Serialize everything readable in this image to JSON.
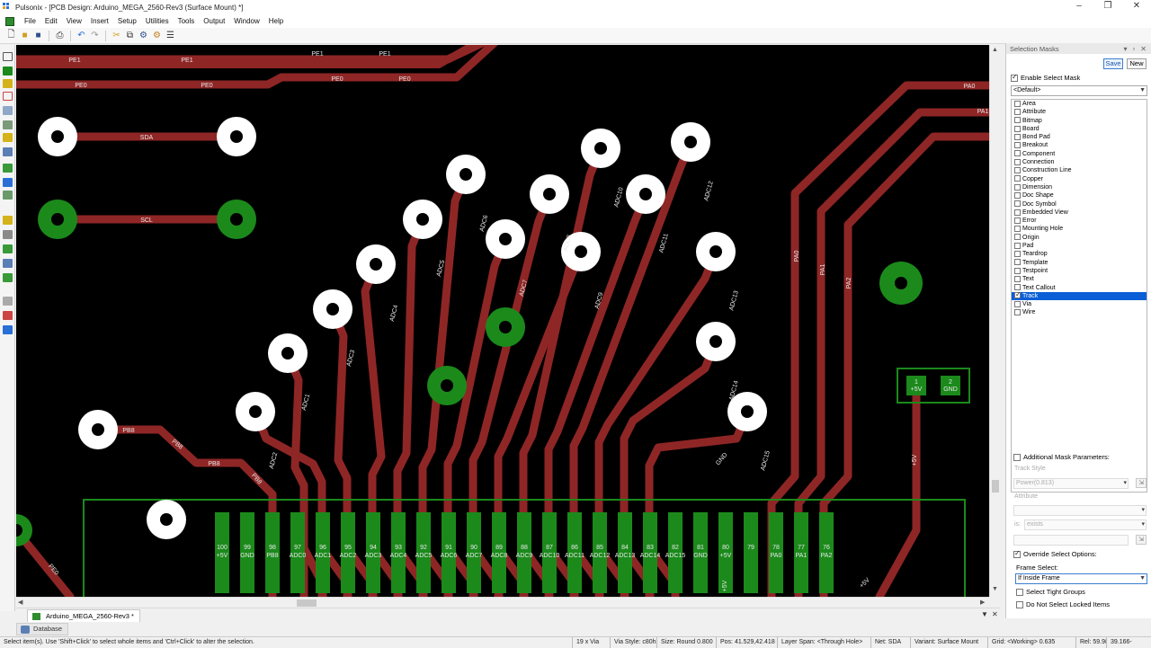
{
  "window": {
    "title": "Pulsonix - [PCB Design: Arduino_MEGA_2560-Rev3 (Surface Mount) *]"
  },
  "menu": [
    "File",
    "Edit",
    "View",
    "Insert",
    "Setup",
    "Utilities",
    "Tools",
    "Output",
    "Window",
    "Help"
  ],
  "canvas": {
    "track_color": "#8f2626",
    "pad_color": "#ffffff",
    "green_color": "#1b8a1b",
    "nets_top": [
      "PE1",
      "PE1",
      "PE1",
      "PE1",
      "PE0",
      "PE0",
      "PE0",
      "PE0",
      "PA0",
      "PA1"
    ],
    "left_labels": [
      "SDA",
      "SCL",
      "PB8",
      "PB8",
      "PB8",
      "PB8"
    ],
    "diag_labels": [
      "ADC1",
      "ADC2",
      "ADC3",
      "ADC4",
      "ADC5",
      "ADC6",
      "ADC7",
      "ADC8",
      "ADC9",
      "ADC10",
      "ADC11",
      "ADC12",
      "ADC13",
      "ADC14",
      "ADC15",
      "GND",
      "PA0",
      "PA1",
      "PA2"
    ],
    "header_pins": [
      {
        "num": "100",
        "net": "+5V"
      },
      {
        "num": "99",
        "net": "GND"
      },
      {
        "num": "98",
        "net": "PB8"
      },
      {
        "num": "97",
        "net": "ADC0"
      },
      {
        "num": "96",
        "net": "ADC1"
      },
      {
        "num": "95",
        "net": "ADC2"
      },
      {
        "num": "94",
        "net": "ADC3"
      },
      {
        "num": "93",
        "net": "ADC4"
      },
      {
        "num": "92",
        "net": "ADC5"
      },
      {
        "num": "91",
        "net": "ADC6"
      },
      {
        "num": "90",
        "net": "ADC7"
      },
      {
        "num": "89",
        "net": "ADC8"
      },
      {
        "num": "88",
        "net": "ADC9"
      },
      {
        "num": "87",
        "net": "ADC10"
      },
      {
        "num": "86",
        "net": "ADC11"
      },
      {
        "num": "85",
        "net": "ADC12"
      },
      {
        "num": "84",
        "net": "ADC13"
      },
      {
        "num": "83",
        "net": "ADC14"
      },
      {
        "num": "82",
        "net": "ADC15"
      },
      {
        "num": "81",
        "net": "GND"
      },
      {
        "num": "80",
        "net": "+5V"
      },
      {
        "num": "79",
        "net": ""
      },
      {
        "num": "78",
        "net": "PA0"
      },
      {
        "num": "77",
        "net": "PA1"
      },
      {
        "num": "76",
        "net": "PA2"
      }
    ],
    "connector": [
      {
        "num": "1",
        "net": "+5V"
      },
      {
        "num": "2",
        "net": "GND"
      }
    ],
    "misc_labels": [
      "+5V",
      "+5V",
      "+5V",
      "PE0"
    ]
  },
  "doc_tab": "Arduino_MEGA_2560-Rev3 *",
  "db_tab": "Database",
  "panel": {
    "title": "Selection Masks",
    "save": "Save",
    "new": "New",
    "enable_label": "Enable Select Mask",
    "mask_value": "<Default>",
    "items": [
      "Area",
      "Attribute",
      "Bitmap",
      "Board",
      "Bond Pad",
      "Breakout",
      "Component",
      "Connection",
      "Construction Line",
      "Copper",
      "Dimension",
      "Doc Shape",
      "Doc Symbol",
      "Embedded View",
      "Error",
      "Mounting Hole",
      "Origin",
      "Pad",
      "Teardrop",
      "Template",
      "Testpoint",
      "Text",
      "Text Callout",
      "Track",
      "Via",
      "Wire"
    ],
    "selected_item": "Track",
    "additional_label": "Additional Mask Parameters:",
    "track_style_label": "Track Style",
    "track_style_value": "Power(0.813)",
    "attribute_label": "Attribute",
    "is_label": "is:",
    "is_value": "exists",
    "override_label": "Override Select Options:",
    "frame_select_label": "Frame Select:",
    "frame_select_value": "If Inside Frame",
    "tight_groups": "Select Tight Groups",
    "not_locked": "Do Not Select Locked Items"
  },
  "status": {
    "hint": "Select item(s). Use 'Shift+Click' to select whole items and 'Ctrl+Click' to alter the selection.",
    "count": "19 x Via",
    "style": "Via Style: c80h35",
    "size": "Size: Round 0.800",
    "pos": "Pos: 41.529,42.418",
    "layer": "Layer Span: <Through Hole>",
    "net": "Net: SDA",
    "variant": "Variant: Surface Mount",
    "grid": "Grid: <Working> 0.635",
    "rel": "Rel: 59.988-",
    "rel2": "39.166-"
  }
}
